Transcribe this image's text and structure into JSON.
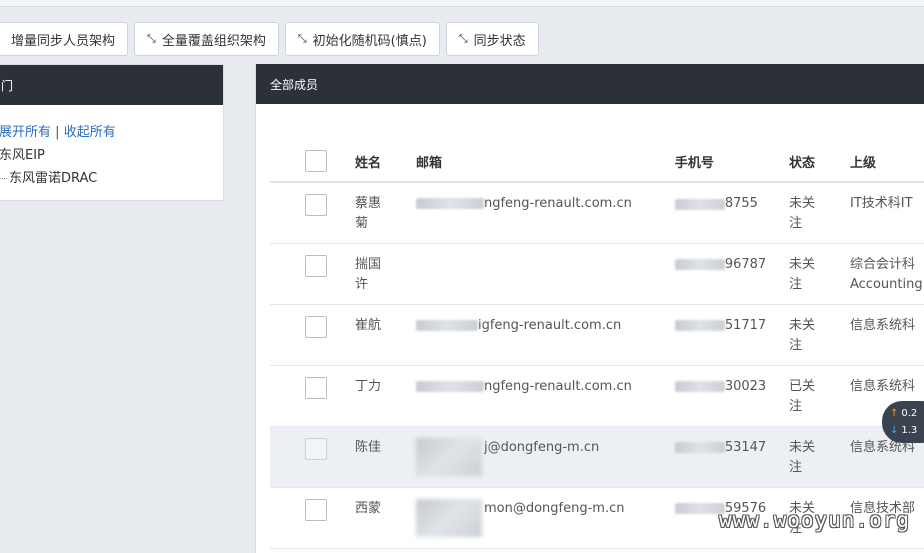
{
  "toolbar": {
    "buttons": [
      {
        "label": "增量同步人员架构",
        "icon": "sync-icon"
      },
      {
        "label": "全量覆盖组织架构",
        "icon": "expand-arrows-icon"
      },
      {
        "label": "初始化随机码(慎点)",
        "icon": "expand-arrows-icon"
      },
      {
        "label": "同步状态",
        "icon": "expand-arrows-icon"
      }
    ]
  },
  "dept_panel": {
    "title": "门",
    "expand_all": "展开所有",
    "separator": "|",
    "collapse_all": "收起所有",
    "root": "东风EIP",
    "child": "东风雷诺DRAC"
  },
  "members_panel": {
    "title": "全部成员",
    "columns": [
      "姓名",
      "邮箱",
      "手机号",
      "状态",
      "上级"
    ],
    "rows": [
      {
        "name": "蔡惠菊",
        "email": "ngfeng-renault.com.cn",
        "phone": "8755",
        "status": "未关注",
        "parent": "IT技术科IT"
      },
      {
        "name": "揣国许",
        "email": "",
        "phone": "96787",
        "status": "未关注",
        "parent": "综合会计科 Accounting"
      },
      {
        "name": "崔航",
        "email": "igfeng-renault.com.cn",
        "phone": "51717",
        "status": "未关注",
        "parent": "信息系统科"
      },
      {
        "name": "丁力",
        "email": "ngfeng-renault.com.cn",
        "phone": "30023",
        "status": "已关注",
        "parent": "信息系统科"
      },
      {
        "name": "陈佳",
        "email": "j@dongfeng-m.cn",
        "phone": "53147",
        "status": "未关注",
        "parent": "信息系统科"
      },
      {
        "name": "西蒙",
        "email": "mon@dongfeng-m.cn",
        "phone": "59576",
        "status": "未关注",
        "parent": "信息技术部"
      }
    ]
  },
  "float_widget": {
    "up": "0.2",
    "down": "1.3"
  },
  "watermark": "www.wooyun.org"
}
